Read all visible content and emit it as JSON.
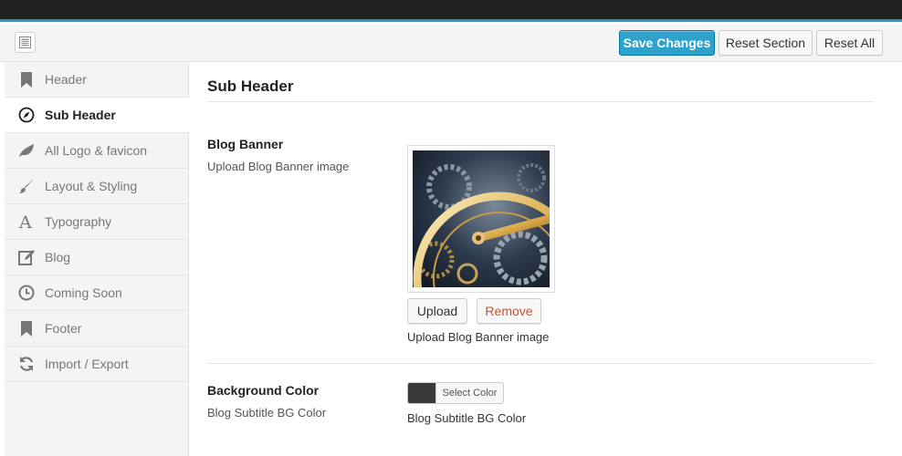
{
  "toolbar": {
    "save_label": "Save Changes",
    "reset_section_label": "Reset Section",
    "reset_all_label": "Reset All"
  },
  "sidebar": {
    "items": [
      {
        "label": "Header",
        "icon": "bookmark-icon",
        "active": false
      },
      {
        "label": "Sub Header",
        "icon": "compass-icon",
        "active": true
      },
      {
        "label": "All Logo & favicon",
        "icon": "leaf-icon",
        "active": false
      },
      {
        "label": "Layout & Styling",
        "icon": "brush-icon",
        "active": false
      },
      {
        "label": "Typography",
        "icon": "font-icon",
        "active": false
      },
      {
        "label": "Blog",
        "icon": "edit-icon",
        "active": false
      },
      {
        "label": "Coming Soon",
        "icon": "clock-icon",
        "active": false
      },
      {
        "label": "Footer",
        "icon": "bookmark-icon",
        "active": false
      },
      {
        "label": "Import / Export",
        "icon": "refresh-icon",
        "active": false
      }
    ]
  },
  "main": {
    "section_title": "Sub Header",
    "blog_banner": {
      "title": "Blog Banner",
      "subtitle": "Upload Blog Banner image",
      "upload_label": "Upload",
      "remove_label": "Remove",
      "description": "Upload Blog Banner image"
    },
    "background_color": {
      "title": "Background Color",
      "subtitle": "Blog Subtitle BG Color",
      "picker_label": "Select Color",
      "selected_color": "#3a3a3a",
      "description": "Blog Subtitle BG Color"
    }
  },
  "colors": {
    "accent": "#2ea2cc",
    "topbar": "#222222",
    "remove": "#d54e21"
  }
}
